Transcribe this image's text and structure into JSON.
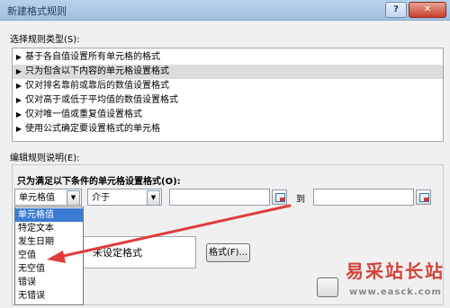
{
  "window": {
    "title": "新建格式规则",
    "help_label": "?",
    "close_label": "✕"
  },
  "select_rule_type": {
    "label": "选择规则类型(S):",
    "items": [
      {
        "label": "基于各自值设置所有单元格的格式"
      },
      {
        "label": "只为包含以下内容的单元格设置格式"
      },
      {
        "label": "仅对排名靠前或靠后的数值设置格式"
      },
      {
        "label": "仅对高于或低于平均值的数值设置格式"
      },
      {
        "label": "仅对唯一值或重复值设置格式"
      },
      {
        "label": "使用公式确定要设置格式的单元格"
      }
    ],
    "selected_index": 1
  },
  "edit_rule": {
    "label": "编辑规则说明(E):",
    "condition_label": "只为满足以下条件的单元格设置格式(O):",
    "type_combo_value": "单元格值",
    "operator_combo_value": "介于",
    "to_label": "到",
    "dropdown_options": [
      "单元格值",
      "特定文本",
      "发生日期",
      "空值",
      "无空值",
      "错误",
      "无错误"
    ],
    "dropdown_selected": 0,
    "preview_text": "未设定格式",
    "format_button_label": "格式(F)..."
  },
  "watermark": {
    "title": "易采站长站",
    "url": "www.easck.com"
  },
  "colors": {
    "selection": "#3b7bd3",
    "arrow": "#e03c3c",
    "watermark": "#d2433a"
  }
}
